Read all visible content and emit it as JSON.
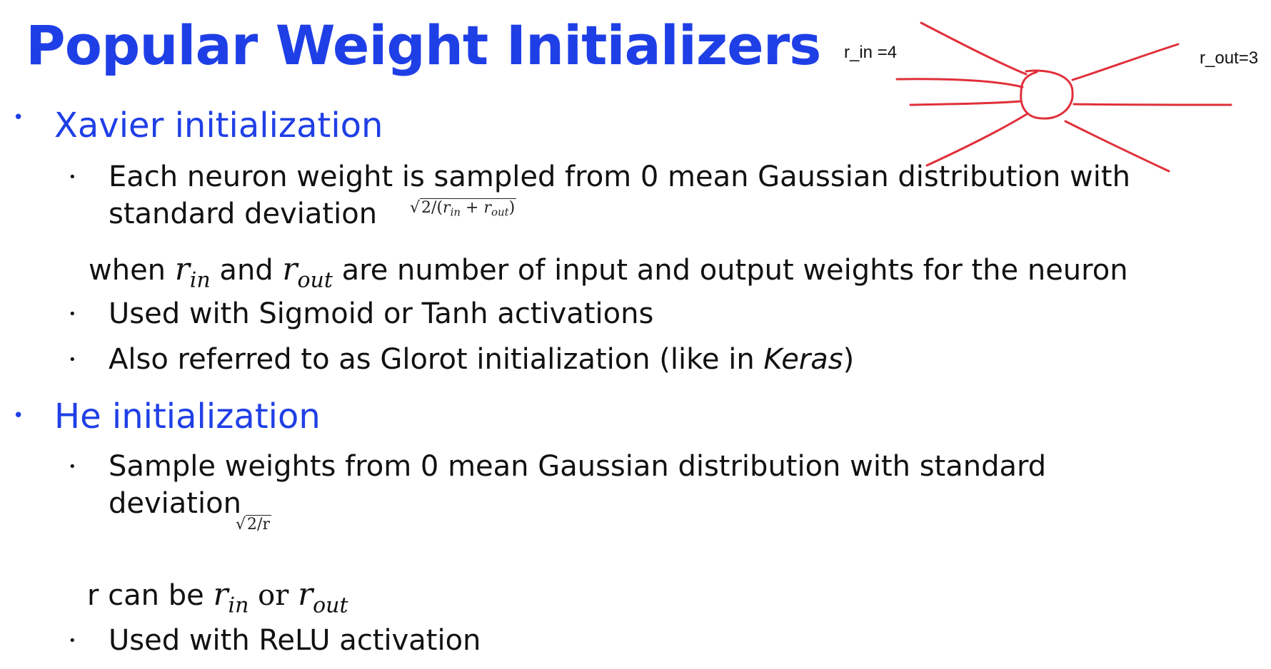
{
  "title": "Popular Weight Initializers",
  "diagram": {
    "r_in_label": "r_in =4",
    "r_out_label": "r_out=3",
    "stroke_color": "#e0303a"
  },
  "xavier": {
    "heading": "Xavier initialization",
    "line1": "Each neuron weight is sampled from 0 mean Gaussian distribution with",
    "line2": "standard  deviation",
    "formula": {
      "numer": "2/(",
      "r": "r",
      "in": "in",
      "plus": " + ",
      "out": "out",
      "close": ")"
    },
    "when": {
      "prefix": "when ",
      "r": "r",
      "in": "in",
      "and": " and ",
      "out": "out",
      "rest": " are number of input and output weights for the neuron"
    },
    "bullet2": "Used with Sigmoid or Tanh activations",
    "bullet3_pre": "Also referred to as Glorot initialization (like in ",
    "bullet3_em": "Keras",
    "bullet3_post": ")"
  },
  "he": {
    "heading": "He initialization",
    "line1": "Sample weights from 0 mean Gaussian distribution with standard",
    "line2": "deviation",
    "formula": "2/r",
    "rcan": {
      "prefix": "r can be ",
      "r": "r",
      "in": "in",
      "or": " or ",
      "out": "out"
    },
    "bullet2": "Used with ReLU activation"
  },
  "bullet_char": "•"
}
